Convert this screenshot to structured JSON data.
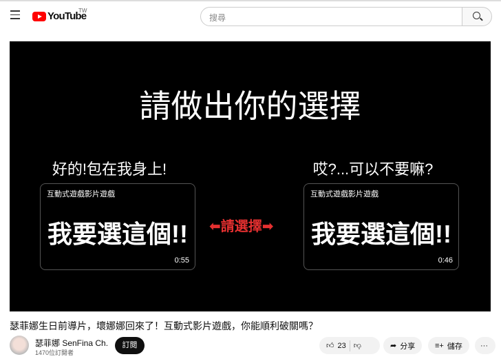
{
  "header": {
    "logo": "YouTube",
    "region": "TW",
    "search_placeholder": "搜尋"
  },
  "video": {
    "heading": "請做出你的選擇",
    "left_option": "好的!包在我身上!",
    "right_option": "哎?...可以不要嘛?",
    "card_label": "互動式遊戲影片遊戲",
    "card_text": "我要選這個!!",
    "left_duration": "0:55",
    "right_duration": "0:46",
    "middle": "⬅請選擇➡"
  },
  "info": {
    "title": "瑟菲娜生日前導片，壞娜娜回來了！互動式影片遊戲，你能順利破關嗎？",
    "channel": "瑟菲娜 SenFina Ch.",
    "subscribers": "1470位訂閱者",
    "subscribe": "訂閱",
    "likes": "23",
    "share": "分享",
    "save": "儲存",
    "more": "···"
  }
}
